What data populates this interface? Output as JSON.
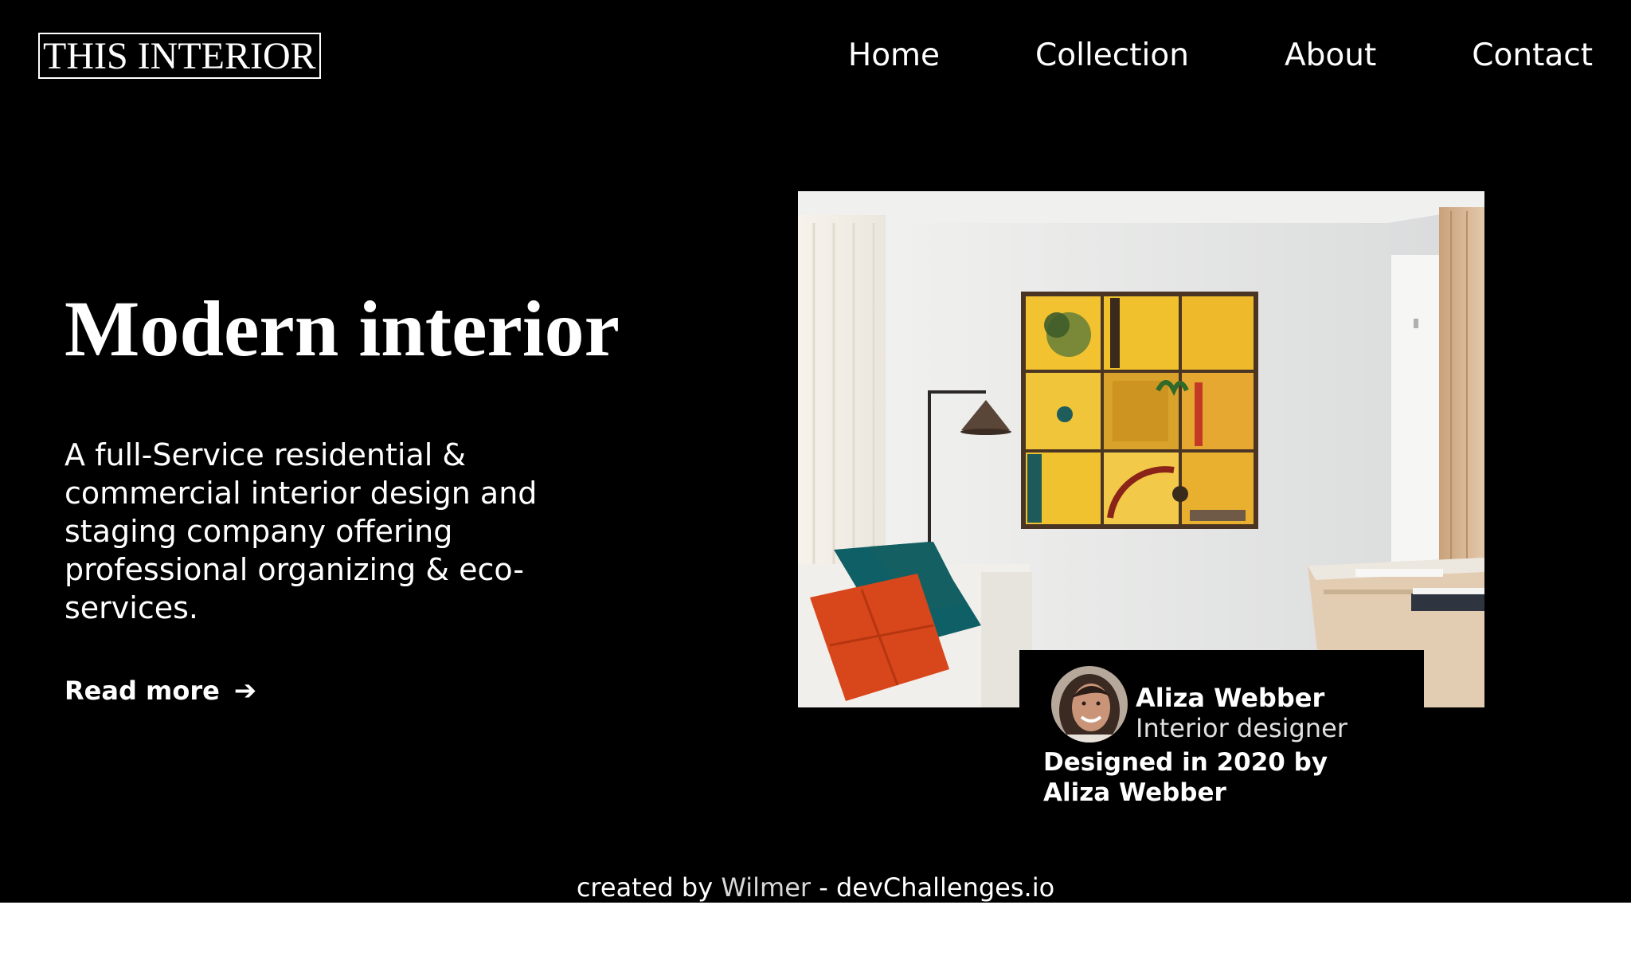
{
  "header": {
    "logo": "THIS INTERIOR",
    "nav": [
      {
        "label": "Home"
      },
      {
        "label": "Collection"
      },
      {
        "label": "About"
      },
      {
        "label": "Contact"
      }
    ]
  },
  "hero": {
    "title": "Modern interior",
    "description": "A full-Service residential & commercial interior design and staging company offering professional organizing & eco-services.",
    "read_more_label": "Read more",
    "read_more_icon": "arrow-right-icon"
  },
  "designer": {
    "name": "Aliza Webber",
    "role": "Interior designer",
    "credit": "Designed in 2020 by Aliza Webber"
  },
  "footer": {
    "prefix": "created by ",
    "author": "Wilmer",
    "separator": " - ",
    "site": "devChallenges.io"
  },
  "colors": {
    "background": "#000000",
    "text": "#ffffff",
    "artwork_yellow": "#f2c230",
    "pillow_orange": "#d8461c",
    "pillow_teal": "#0f5f66"
  }
}
